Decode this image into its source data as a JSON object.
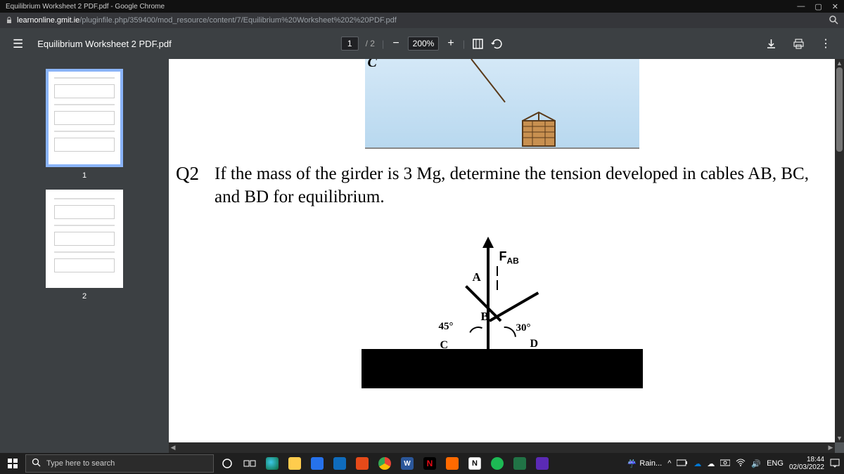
{
  "browser": {
    "tab_title": "Equilibrium Worksheet 2 PDF.pdf - Google Chrome",
    "url_host": "learnonline.gmit.ie",
    "url_path": "/pluginfile.php/359400/mod_resource/content/7/Equilibrium%20Worksheet%202%20PDF.pdf"
  },
  "pdf": {
    "filename": "Equilibrium Worksheet 2 PDF.pdf",
    "current_page": "1",
    "page_sep": "/ 2",
    "zoom": "200%",
    "thumbs": [
      "1",
      "2"
    ]
  },
  "document": {
    "top_label": "C",
    "q_number": "Q2",
    "q_text": "If the mass of the girder is 3 Mg, determine the tension developed in cables AB, BC, and BD for equilibrium.",
    "labels": {
      "fab": "F",
      "fab_sub": "AB",
      "A": "A",
      "B": "B",
      "C": "C",
      "D": "D",
      "ang45": "45°",
      "ang30": "30°"
    }
  },
  "taskbar": {
    "search_placeholder": "Type here to search",
    "weather": "Rain...",
    "lang": "ENG",
    "time": "18:44",
    "date": "02/03/2022"
  }
}
